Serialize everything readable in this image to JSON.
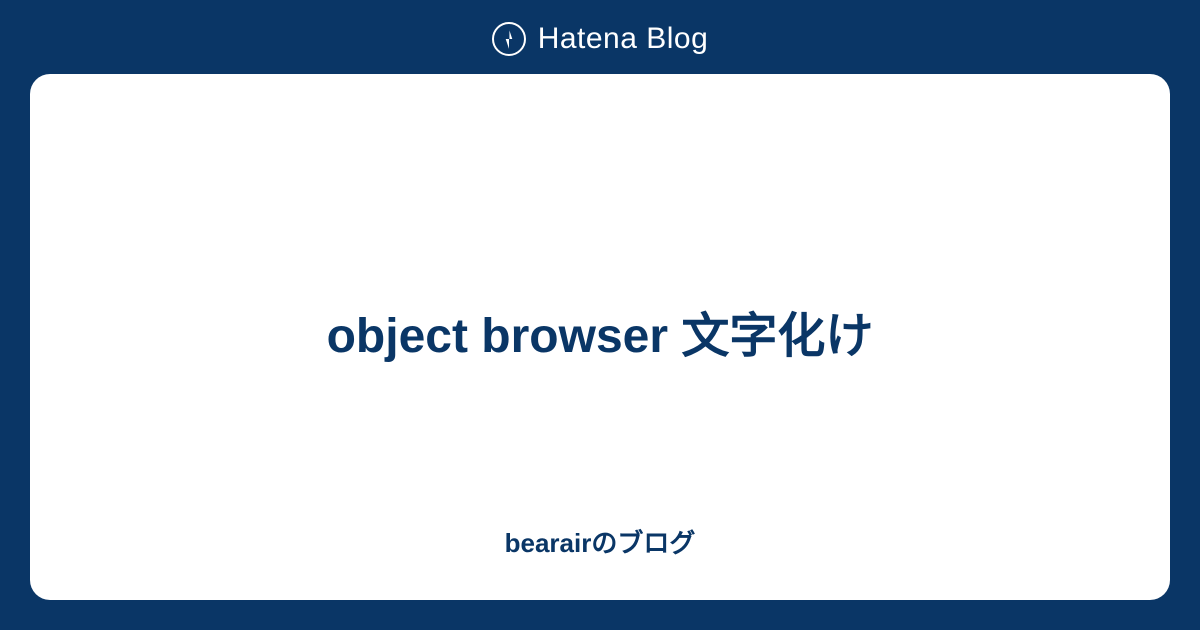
{
  "header": {
    "logo_text": "Hatena Blog"
  },
  "card": {
    "title": "object browser 文字化け",
    "blog_name": "bearairのブログ"
  }
}
